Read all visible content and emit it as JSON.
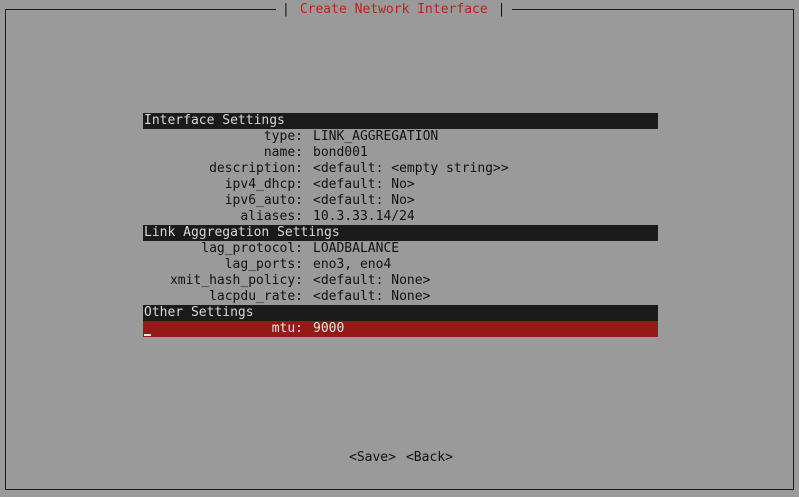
{
  "window": {
    "title": "Create Network Interface",
    "left_bracket": "|",
    "right_bracket": "|"
  },
  "sections": [
    {
      "header": "Interface Settings",
      "rows": [
        {
          "key": "type:",
          "value": "LINK_AGGREGATION"
        },
        {
          "key": "name:",
          "value": "bond001"
        },
        {
          "key": "description:",
          "value": "<default: <empty string>>"
        },
        {
          "key": "ipv4_dhcp:",
          "value": "<default: No>"
        },
        {
          "key": "ipv6_auto:",
          "value": "<default: No>"
        },
        {
          "key": "aliases:",
          "value": "10.3.33.14/24"
        }
      ]
    },
    {
      "header": "Link Aggregation Settings",
      "rows": [
        {
          "key": "lag_protocol:",
          "value": "LOADBALANCE"
        },
        {
          "key": "lag_ports:",
          "value": "eno3, eno4"
        },
        {
          "key": "xmit_hash_policy:",
          "value": "<default: None>"
        },
        {
          "key": "lacpdu_rate:",
          "value": "<default: None>"
        }
      ]
    },
    {
      "header": "Other Settings",
      "rows": [
        {
          "key": "mtu:",
          "value": "9000",
          "selected": true
        }
      ]
    }
  ],
  "buttons": {
    "save": "<Save>",
    "back": "<Back>"
  },
  "colors": {
    "background": "#9a9a9a",
    "header_bg": "#1b1b1b",
    "selected_bg": "#951916",
    "title_text": "#c0201a"
  }
}
